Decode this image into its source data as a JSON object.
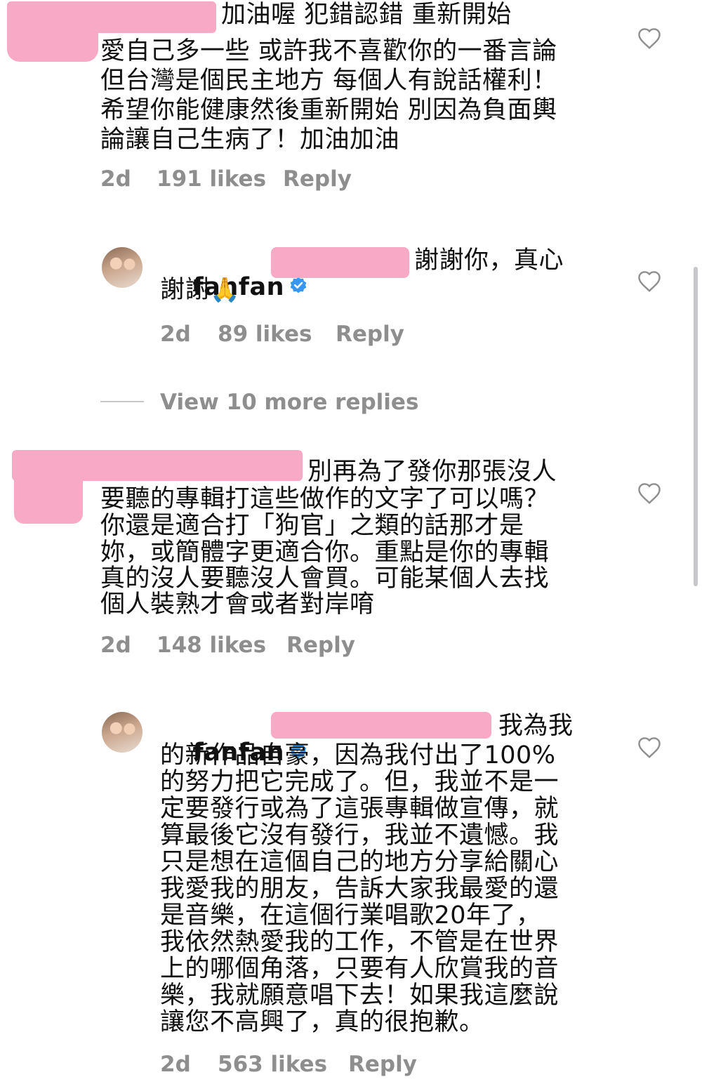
{
  "comments": [
    {
      "lines": [
        "加油喔 犯錯認錯 重新開始",
        "愛自己多一些 或許我不喜歡你的一番言論",
        "但台灣是個民主地方 每個人有說話權利！",
        "希望你能健康然後重新開始 別因為負面輿",
        "論讓自己生病了！加油加油"
      ],
      "time": "2d",
      "likes": "191 likes",
      "reply": "Reply"
    },
    {
      "username": "fanfan",
      "lines": [
        "謝謝你，真心",
        "謝謝"
      ],
      "emoji": "🙏",
      "time": "2d",
      "likes": "89 likes",
      "reply": "Reply"
    },
    {
      "lines": [
        "別再為了發你那張沒人",
        "要聽的專輯打這些做作的文字了可以嗎？",
        "你還是適合打「狗官」之類的話那才是",
        "妳，或簡體字更適合你。重點是你的專輯",
        "真的沒人要聽沒人會買。可能某個人去找",
        "個人裝熟才會或者對岸唷"
      ],
      "time": "2d",
      "likes": "148 likes",
      "reply": "Reply"
    },
    {
      "username": "fanfan",
      "lines": [
        "我為我",
        "的新作品自豪，因為我付出了100%",
        "的努力把它完成了。但，我並不是一",
        "定要發行或為了這張專輯做宣傳，就",
        "算最後它沒有發行，我並不遺憾。我",
        "只是想在這個自己的地方分享給關心",
        "我愛我的朋友，告訴大家我最愛的還",
        "是音樂，在這個行業唱歌20年了，",
        "我依然熱愛我的工作，不管是在世界",
        "上的哪個角落，只要有人欣賞我的音",
        "樂，我就願意唱下去！如果我這麼說",
        "讓您不高興了，真的很抱歉。"
      ],
      "time": "2d",
      "likes": "563 likes",
      "reply": "Reply"
    }
  ],
  "view_more": "View 10 more replies",
  "colors": {
    "redaction": "#f8a9c6",
    "meta": "#8e8e8e",
    "verified": "#3897f0"
  },
  "icons": {
    "like": "heart-outline-icon",
    "verified": "verified-badge-icon"
  }
}
